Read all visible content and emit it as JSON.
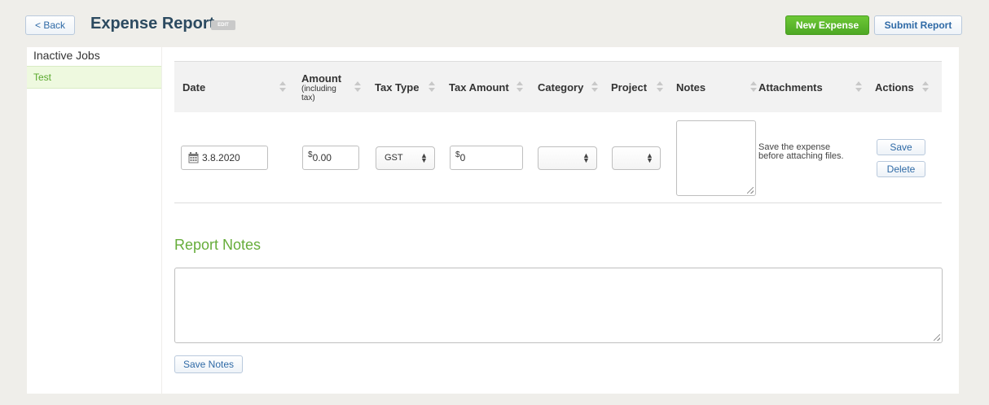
{
  "header": {
    "back_label": "< Back",
    "title": "Expense Report",
    "edit_badge": "EDIT",
    "new_expense_label": "New Expense",
    "submit_label": "Submit Report"
  },
  "sidebar": {
    "items": [
      {
        "label": "Inactive Jobs",
        "active": false
      },
      {
        "label": "Test",
        "active": true
      }
    ]
  },
  "table": {
    "columns": [
      {
        "label": "Date"
      },
      {
        "label": "Amount",
        "sub": "(including tax)"
      },
      {
        "label": "Tax Type"
      },
      {
        "label": "Tax Amount"
      },
      {
        "label": "Category"
      },
      {
        "label": "Project"
      },
      {
        "label": "Notes"
      },
      {
        "label": "Attachments"
      },
      {
        "label": "Actions"
      }
    ],
    "row": {
      "date": "3.8.2020",
      "currency_symbol": "$",
      "amount": "0.00",
      "tax_type": "GST",
      "tax_amount": "0",
      "category": "",
      "project": "",
      "notes": "",
      "attachments_note": "Save the expense before attaching files.",
      "save_label": "Save",
      "delete_label": "Delete"
    }
  },
  "report_notes": {
    "title": "Report Notes",
    "value": "",
    "save_label": "Save Notes"
  },
  "icons": [
    "calendar-icon",
    "sort-icon",
    "select-chevron-icon",
    "resize-handle-icon"
  ],
  "colors": {
    "accent_green": "#66ad3a",
    "button_green": "#5cb82c",
    "link_blue": "#2f6aa6",
    "title_dark": "#2c4a60",
    "background": "#efeeea"
  }
}
